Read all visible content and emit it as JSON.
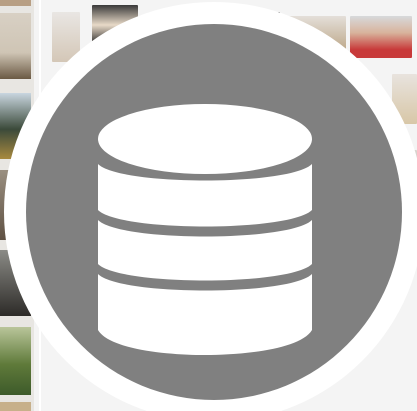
{
  "icon": {
    "name": "database-icon",
    "badge_color": "#808080",
    "ring_color": "#ffffff",
    "glyph_color": "#ffffff"
  },
  "background": {
    "description_colors": {
      "page": "#f4f4f4",
      "strip": "#e8e6e2"
    }
  }
}
